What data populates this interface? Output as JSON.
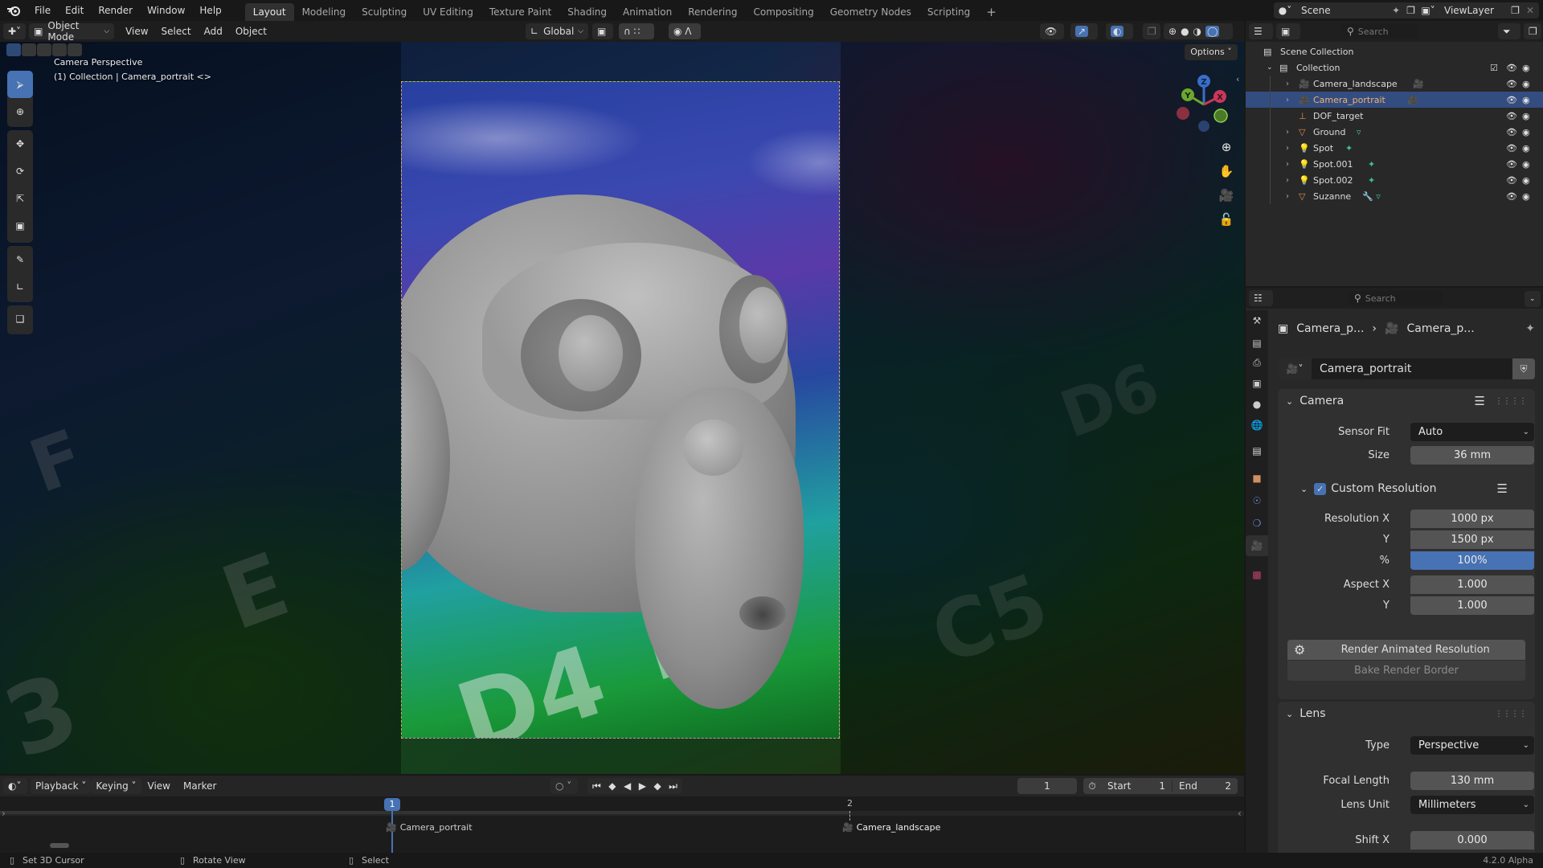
{
  "topbar": {
    "menus": [
      "File",
      "Edit",
      "Render",
      "Window",
      "Help"
    ],
    "workspaces": [
      "Layout",
      "Modeling",
      "Sculpting",
      "UV Editing",
      "Texture Paint",
      "Shading",
      "Animation",
      "Rendering",
      "Compositing",
      "Geometry Nodes",
      "Scripting"
    ],
    "active_workspace": "Layout",
    "add_tab": "+",
    "scene": "Scene",
    "view_layer": "ViewLayer"
  },
  "viewport_header": {
    "mode": "Object Mode",
    "menus": [
      "View",
      "Select",
      "Add",
      "Object"
    ],
    "orientation": "Global",
    "options": "Options"
  },
  "viewport": {
    "overlay_line1": "Camera Perspective",
    "overlay_line2": "(1) Collection | Camera_portrait <>",
    "gizmo": {
      "x": "X",
      "y": "Y",
      "z": "Z"
    }
  },
  "outliner": {
    "search_placeholder": "Search",
    "scene_collection": "Scene Collection",
    "collection": "Collection",
    "items": [
      {
        "name": "Camera_landscape",
        "type": "camera",
        "selected": false
      },
      {
        "name": "Camera_portrait",
        "type": "camera",
        "selected": true
      },
      {
        "name": "DOF_target",
        "type": "empty",
        "selected": false
      },
      {
        "name": "Ground",
        "type": "mesh",
        "selected": false
      },
      {
        "name": "Spot",
        "type": "light",
        "selected": false
      },
      {
        "name": "Spot.001",
        "type": "light",
        "selected": false
      },
      {
        "name": "Spot.002",
        "type": "light",
        "selected": false
      },
      {
        "name": "Suzanne",
        "type": "mesh",
        "selected": false
      }
    ]
  },
  "properties": {
    "search_placeholder": "Search",
    "breadcrumb": [
      "Camera_p...",
      "Camera_p..."
    ],
    "datablock_name": "Camera_portrait",
    "camera_panel": {
      "title": "Camera",
      "sensor_fit_label": "Sensor Fit",
      "sensor_fit": "Auto",
      "size_label": "Size",
      "size": "36 mm",
      "custom_resolution_label": "Custom Resolution",
      "custom_resolution_enabled": true,
      "res_x_label": "Resolution X",
      "res_x": "1000 px",
      "res_y_label": "Y",
      "res_y": "1500 px",
      "percent_label": "%",
      "percent": "100%",
      "aspect_x_label": "Aspect X",
      "aspect_x": "1.000",
      "aspect_y_label": "Y",
      "aspect_y": "1.000",
      "render_animated_button": "Render Animated Resolution",
      "bake_border_button": "Bake Render Border"
    },
    "lens_panel": {
      "title": "Lens",
      "type_label": "Type",
      "type": "Perspective",
      "focal_label": "Focal Length",
      "focal": "130 mm",
      "unit_label": "Lens Unit",
      "unit": "Millimeters",
      "shift_x_label": "Shift X",
      "shift_x": "0.000"
    }
  },
  "timeline": {
    "menus": [
      "Playback",
      "Keying",
      "View",
      "Marker"
    ],
    "current_frame": "1",
    "start_label": "Start",
    "start": "1",
    "end_label": "End",
    "end": "2",
    "frame_marker_1": "1",
    "frame_marker_2": "2",
    "marker_1": "Camera_portrait",
    "marker_2": "Camera_landscape"
  },
  "statusbar": {
    "left": "Set 3D Cursor",
    "middle": "Rotate View",
    "right": "Select",
    "version": "4.2.0 Alpha"
  },
  "colors": {
    "accent": "#4772b3",
    "selection_row": "#334d80",
    "object_orange": "#e09050",
    "data_teal": "#3bbfa0"
  }
}
